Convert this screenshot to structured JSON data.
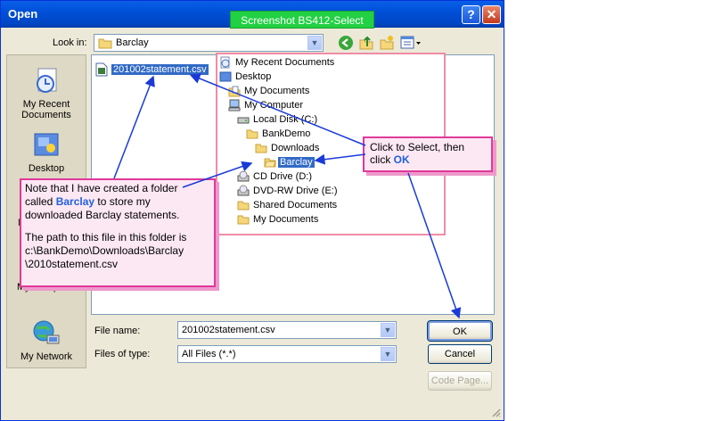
{
  "window": {
    "title": "Open",
    "help_label": "?",
    "close_label": "✕"
  },
  "banner": "Screenshot BS412-Select",
  "lookin": {
    "label": "Look in:",
    "value": "Barclay"
  },
  "places": [
    {
      "label_line1": "My Recent",
      "label_line2": "Documents",
      "icon": "recent-docs-icon"
    },
    {
      "label_line1": "Desktop",
      "label_line2": "",
      "icon": "desktop-icon"
    },
    {
      "label_line1": "M",
      "label_line2": "",
      "icon": "my-documents-icon"
    },
    {
      "label_line1": "My Computer",
      "label_line2": "",
      "icon": "my-computer-icon"
    },
    {
      "label_line1": "My Network",
      "label_line2": "",
      "icon": "my-network-icon"
    }
  ],
  "file": {
    "name": "201002statement.csv"
  },
  "tree": [
    {
      "label": "My Recent Documents",
      "icon": "recent-docs-icon"
    },
    {
      "label": "Desktop",
      "icon": "desktop-icon"
    },
    {
      "label": "My Documents",
      "icon": "my-documents-icon"
    },
    {
      "label": "My Computer",
      "icon": "my-computer-icon"
    },
    {
      "label": "Local Disk (C:)",
      "icon": "hard-disk-icon"
    },
    {
      "label": "BankDemo",
      "icon": "folder-icon"
    },
    {
      "label": "Downloads",
      "icon": "folder-icon"
    },
    {
      "label": "Barclay",
      "icon": "open-folder-icon",
      "selected": true
    },
    {
      "label": "CD Drive (D:)",
      "icon": "cd-drive-icon"
    },
    {
      "label": "DVD-RW Drive (E:)",
      "icon": "dvd-drive-icon"
    },
    {
      "label": "Shared Documents",
      "icon": "folder-icon"
    },
    {
      "label": "My Documents",
      "icon": "folder-icon"
    }
  ],
  "callout_select": {
    "line1": "Click to Select, then",
    "line2_pre": "click ",
    "line2_bold": "OK"
  },
  "callout_note": {
    "line1": "Note that I have created a folder",
    "line2_pre": "called ",
    "line2_bold": "Barclay",
    "line2_post": " to store my",
    "line3": "downloaded Barclay statements.",
    "line4": "The path to this file in this folder is",
    "line5": "c:\\BankDemo\\Downloads\\Barclay",
    "line6": "\\2010statement.csv"
  },
  "filename": {
    "label": "File name:",
    "value": "201002statement.csv"
  },
  "filetype": {
    "label": "Files of type:",
    "value": "All Files (*.*)"
  },
  "buttons": {
    "ok": "OK",
    "cancel": "Cancel",
    "codepage": "Code Page..."
  }
}
